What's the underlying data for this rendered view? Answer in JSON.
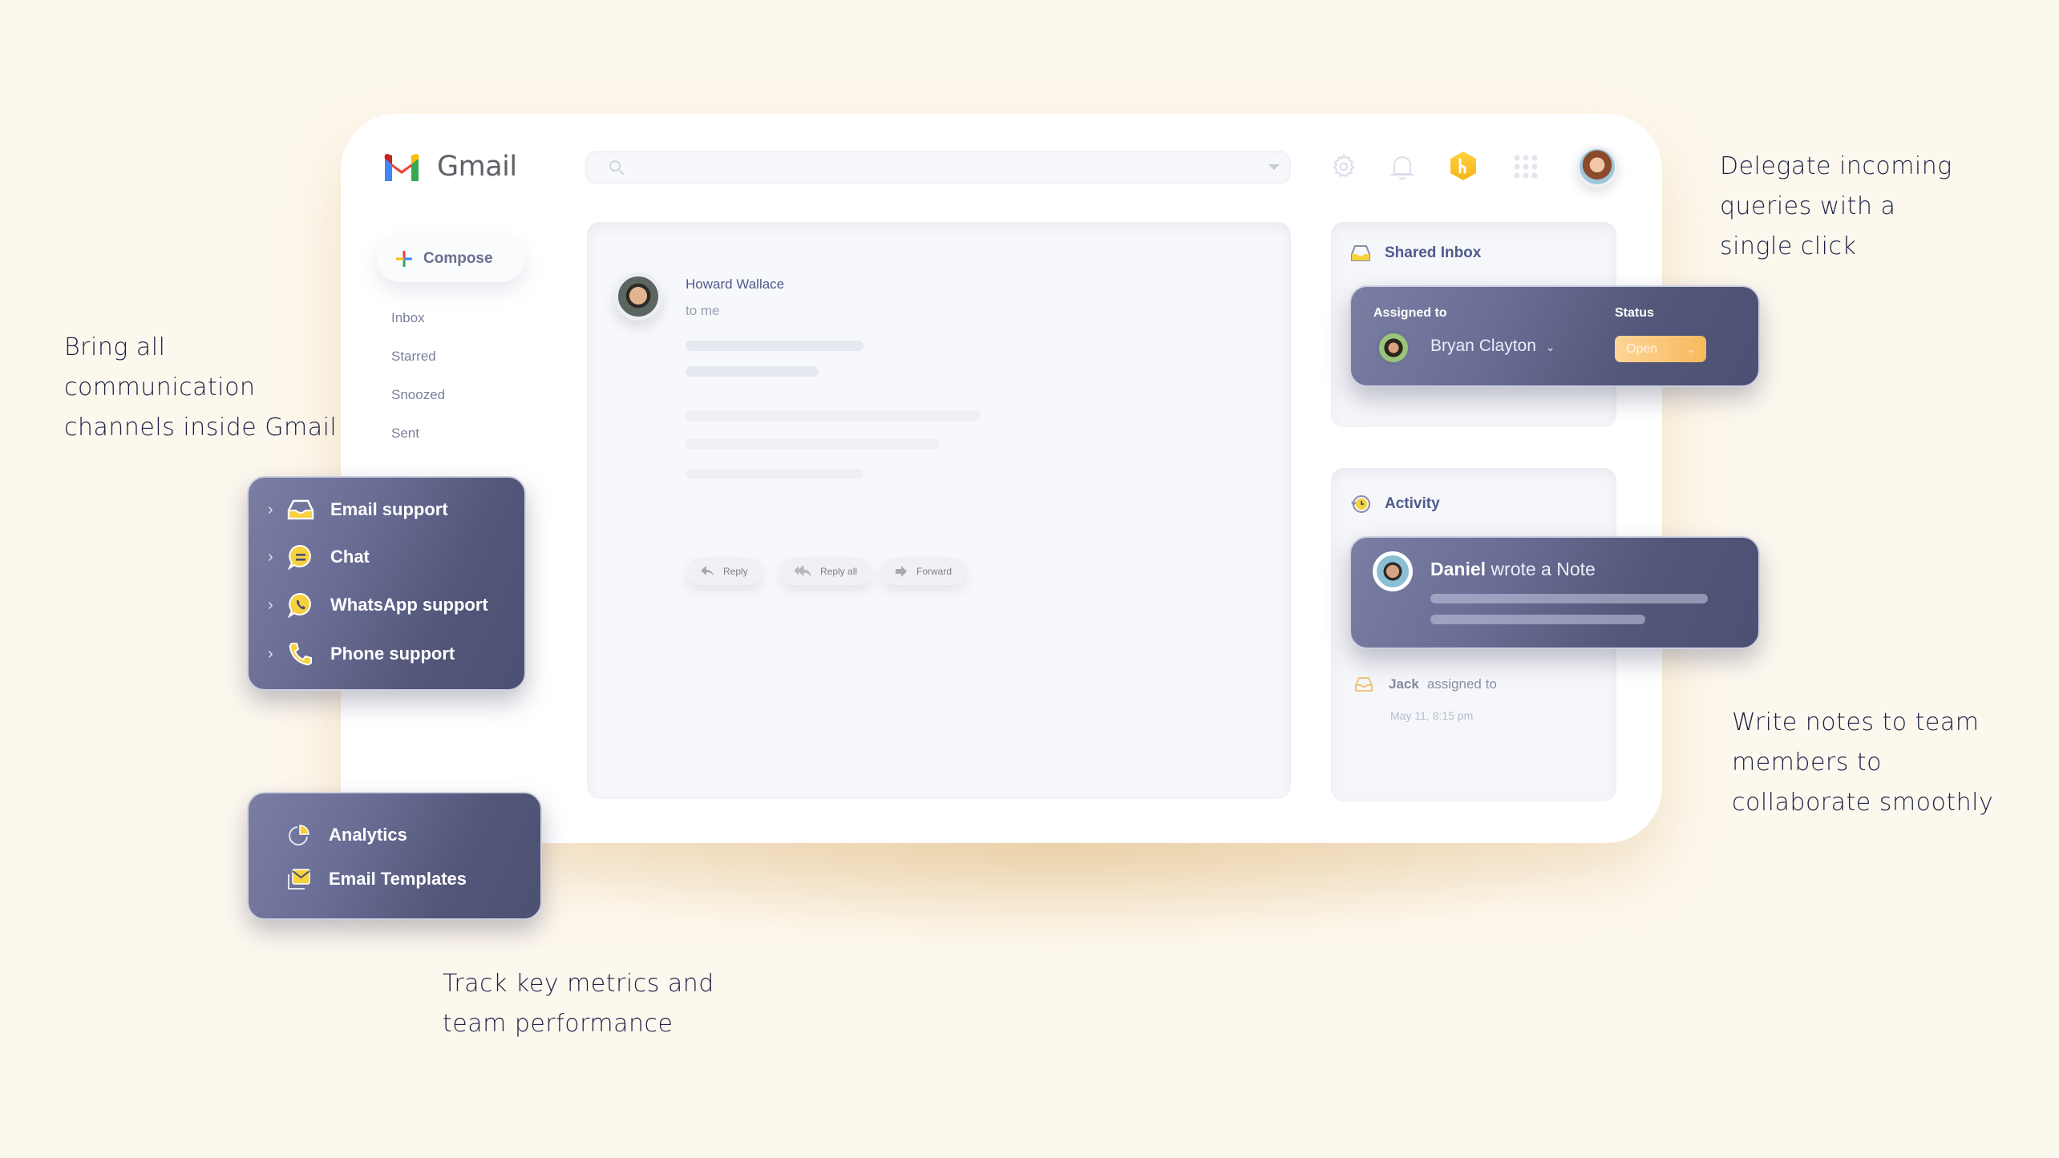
{
  "app": {
    "name": "Gmail"
  },
  "search": {
    "placeholder": ""
  },
  "header_icons": [
    "settings-icon",
    "bell-icon",
    "hiver-logo-icon",
    "apps-grid-icon",
    "user-avatar"
  ],
  "sidebar": {
    "compose_label": "Compose",
    "items": [
      {
        "label": "Inbox"
      },
      {
        "label": "Starred"
      },
      {
        "label": "Snoozed"
      },
      {
        "label": "Sent"
      }
    ]
  },
  "email": {
    "sender": "Howard Wallace",
    "recipient": "to me",
    "actions": [
      {
        "label": "Reply",
        "icon": "reply-icon"
      },
      {
        "label": "Reply all",
        "icon": "reply-all-icon"
      },
      {
        "label": "Forward",
        "icon": "forward-icon"
      }
    ]
  },
  "shared_inbox": {
    "title": "Shared Inbox",
    "assigned_label": "Assigned to",
    "assignee": "Bryan Clayton",
    "status_label": "Status",
    "status_value": "Open",
    "status_color": "#f7b95e"
  },
  "activity": {
    "title": "Activity",
    "note_author": "Daniel",
    "note_text": "wrote a Note",
    "log_actor": "Jack",
    "log_text": "assigned to",
    "log_time": "May 11, 8:15 pm"
  },
  "channels": {
    "items": [
      {
        "label": "Email support",
        "icon": "inbox-tray-icon"
      },
      {
        "label": "Chat",
        "icon": "chat-bubble-icon"
      },
      {
        "label": "WhatsApp support",
        "icon": "whatsapp-icon"
      },
      {
        "label": "Phone support",
        "icon": "phone-icon"
      }
    ]
  },
  "features": {
    "items": [
      {
        "label": "Analytics",
        "icon": "pie-chart-icon"
      },
      {
        "label": "Email Templates",
        "icon": "email-templates-icon"
      }
    ]
  },
  "annotations": {
    "channels": [
      "Bring all",
      "communication",
      "channels inside Gmail"
    ],
    "delegate": [
      "Delegate incoming",
      "queries with a",
      "single click"
    ],
    "notes": [
      "Write notes to team",
      "members to",
      "collaborate smoothly"
    ],
    "metrics": [
      "Track key metrics and",
      "team performance"
    ]
  },
  "colors": {
    "background": "#fdf8ee",
    "accent_navy": "#4f5a8d",
    "card_dark": "#5a5e82",
    "accent_yellow": "#f6d13d"
  }
}
